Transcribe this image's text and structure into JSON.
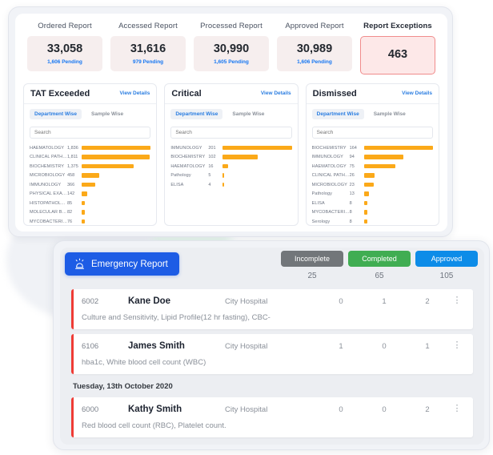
{
  "kpis": [
    {
      "title": "Ordered Report",
      "value": "33,058",
      "pending": "1,606 Pending",
      "alert": false
    },
    {
      "title": "Accessed Report",
      "value": "31,616",
      "pending": "979 Pending",
      "alert": false
    },
    {
      "title": "Processed Report",
      "value": "30,990",
      "pending": "1,605 Pending",
      "alert": false
    },
    {
      "title": "Approved Report",
      "value": "30,989",
      "pending": "1,606 Pending",
      "alert": false
    },
    {
      "title": "Report Exceptions",
      "value": "463",
      "pending": "",
      "alert": true
    }
  ],
  "panels": [
    {
      "title": "TAT Exceeded",
      "view_details": "View Details",
      "tabs": [
        {
          "label": "Department Wise",
          "active": true
        },
        {
          "label": "Sample Wise",
          "active": false
        }
      ],
      "search_placeholder": "Search",
      "chart_data": {
        "type": "bar",
        "title": "TAT Exceeded",
        "orientation": "horizontal",
        "xlabel": "",
        "ylabel": "",
        "categories": [
          "HAEMATOLOGY",
          "CLINICAL PATHOL...",
          "BIOCHEMISTRY",
          "MICROBIOLOGY",
          "IMMUNOLOGY",
          "PHYSICAL EXAMIN...",
          "HISTOPATHOLOGY",
          "MOLECULAR BIOL...",
          "MYCOBACTERIOLO..."
        ],
        "values": [
          1836,
          1811,
          1375,
          458,
          366,
          142,
          85,
          82,
          76
        ],
        "value_labels": [
          "1,836",
          "1,811",
          "1,375",
          "458",
          "366",
          "142",
          "85",
          "82",
          "76"
        ],
        "max": 1836,
        "bar_color": "#fba919"
      }
    },
    {
      "title": "Critical",
      "view_details": "View Details",
      "tabs": [
        {
          "label": "Department Wise",
          "active": true
        },
        {
          "label": "Sample Wise",
          "active": false
        }
      ],
      "search_placeholder": "Search",
      "chart_data": {
        "type": "bar",
        "title": "Critical",
        "orientation": "horizontal",
        "xlabel": "",
        "ylabel": "",
        "categories": [
          "IMMUNOLOGY",
          "BIOCHEMISTRY",
          "HAEMATOLOGY",
          "Pathology",
          "ELISA"
        ],
        "values": [
          201,
          102,
          16,
          5,
          4
        ],
        "value_labels": [
          "201",
          "102",
          "16",
          "5",
          "4"
        ],
        "max": 201,
        "bar_color": "#fba919"
      }
    },
    {
      "title": "Dismissed",
      "view_details": "View Details",
      "tabs": [
        {
          "label": "Department Wise",
          "active": true
        },
        {
          "label": "Sample Wise",
          "active": false
        }
      ],
      "search_placeholder": "Search",
      "chart_data": {
        "type": "bar",
        "title": "Dismissed",
        "orientation": "horizontal",
        "xlabel": "",
        "ylabel": "",
        "categories": [
          "BIOCHEMISTRY",
          "IMMUNOLOGY",
          "HAEMATOLOGY",
          "CLINICAL PATHOL...",
          "MICROBIOLOGY",
          "Pathology",
          "ELISA",
          "MYCOBACTERIOLO...",
          "Serology"
        ],
        "values": [
          164,
          94,
          75,
          26,
          23,
          13,
          8,
          8,
          8
        ],
        "value_labels": [
          "164",
          "94",
          "75",
          "26",
          "23",
          "13",
          "8",
          "8",
          "8"
        ],
        "max": 164,
        "bar_color": "#fba919"
      }
    }
  ],
  "emergency": {
    "button_label": "Emergency Report",
    "button_icon": "siren-icon",
    "statuses": [
      {
        "label": "Incomplete",
        "count": "25",
        "color": "#72767a"
      },
      {
        "label": "Completed",
        "count": "65",
        "color": "#40ad52"
      },
      {
        "label": "Approved",
        "count": "105",
        "color": "#0d8ce8"
      }
    ],
    "rows": [
      {
        "type": "row",
        "id": "6002",
        "name": "Kane Doe",
        "hospital": "City Hospital",
        "n1": "0",
        "n2": "1",
        "n3": "2",
        "tests": "Culture and Sensitivity, Lipid Profile(12 hr fasting), CBC-"
      },
      {
        "type": "row",
        "id": "6106",
        "name": "James Smith",
        "hospital": "City Hospital",
        "n1": "1",
        "n2": "0",
        "n3": "1",
        "tests": "hba1c, White blood cell count (WBC)"
      },
      {
        "type": "date",
        "label": "Tuesday, 13th October 2020"
      },
      {
        "type": "row",
        "id": "6000",
        "name": "Kathy Smith",
        "hospital": "City Hospital",
        "n1": "0",
        "n2": "0",
        "n3": "2",
        "tests": "Red blood cell count (RBC), Platelet count."
      }
    ]
  }
}
